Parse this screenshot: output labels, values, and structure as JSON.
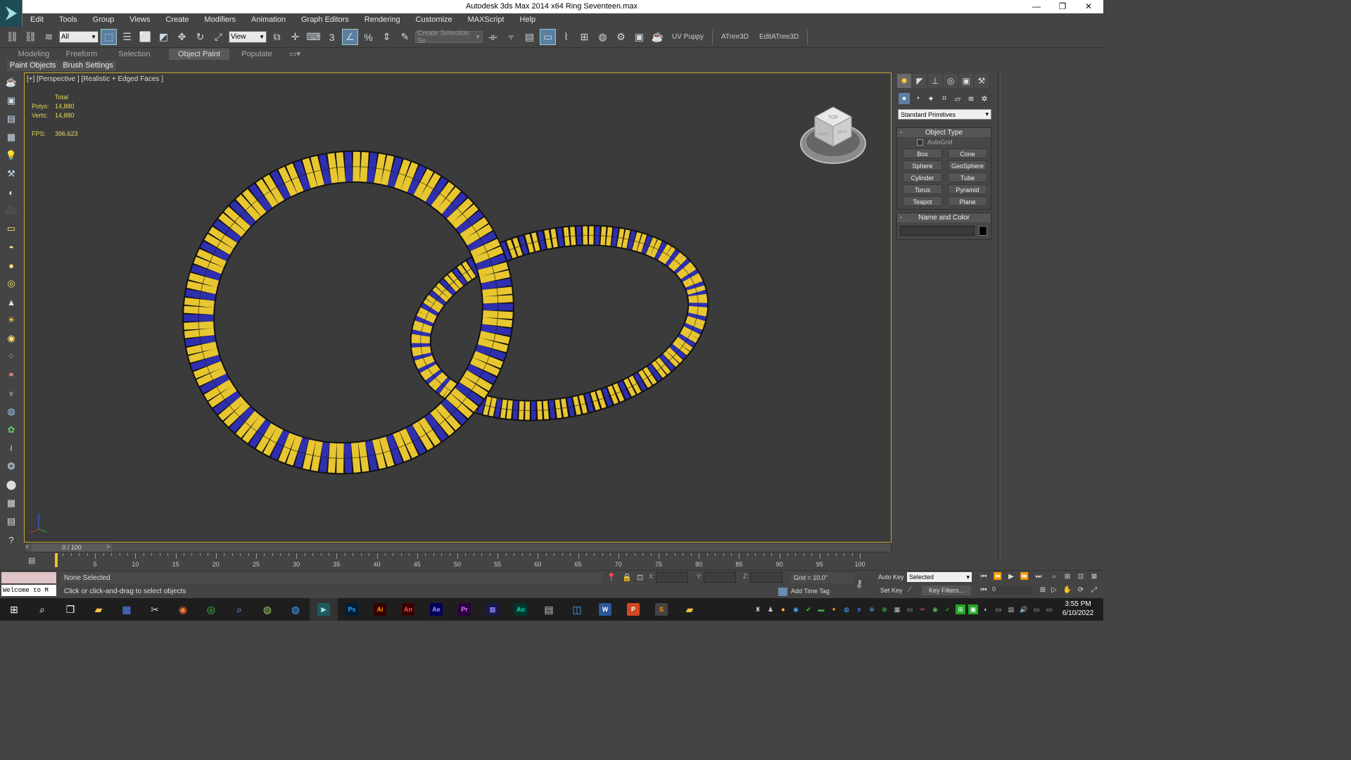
{
  "window": {
    "title": "Autodesk 3ds Max  2014 x64     Ring Seventeen.max",
    "minimize": "—",
    "restore": "❐",
    "close": "✕"
  },
  "menu": [
    "Edit",
    "Tools",
    "Group",
    "Views",
    "Create",
    "Modifiers",
    "Animation",
    "Graph Editors",
    "Rendering",
    "Customize",
    "MAXScript",
    "Help"
  ],
  "toolbar": {
    "selection_filter": "All",
    "ref_coord": "View",
    "named_selection": "Create Selection Se",
    "uv_puppy": "UV Puppy",
    "atree": "ATree3D",
    "editatree": "EditATree3D",
    "snap_2d": "3",
    "percent_snap": "%"
  },
  "ribbon": {
    "tabs": [
      "Modeling",
      "Freeform",
      "Selection",
      "Object Paint",
      "Populate"
    ],
    "active_tab": "Object Paint",
    "subtabs": [
      "Paint Objects",
      "Brush Settings"
    ]
  },
  "viewport": {
    "label": "[+] [Perspective ] [Realistic + Edged Faces ]",
    "stats": {
      "header": "Total",
      "polys_label": "Polys:",
      "polys": "14,880",
      "verts_label": "Verts:",
      "verts": "14,880",
      "fps_label": "FPS:",
      "fps": "396.623"
    },
    "viewcube": {
      "top": "TOP",
      "left": "RIGHT",
      "right": "BACK"
    },
    "ring_colors": {
      "gold": "#e8c630",
      "blue": "#2f2fb0",
      "edge": "#1a1a10"
    }
  },
  "command_panel": {
    "category": "Standard Primitives",
    "object_type": {
      "title": "Object Type",
      "autogrid": "AutoGrid",
      "buttons": [
        "Box",
        "Cone",
        "Sphere",
        "GeoSphere",
        "Cylinder",
        "Tube",
        "Torus",
        "Pyramid",
        "Teapot",
        "Plane"
      ]
    },
    "name_color": {
      "title": "Name and Color",
      "name": ""
    }
  },
  "timeline": {
    "slider": "0 / 100",
    "ticks": [
      "5",
      "10",
      "15",
      "20",
      "25",
      "30",
      "35",
      "40",
      "45",
      "50",
      "55",
      "60",
      "65",
      "70",
      "75",
      "80",
      "85",
      "90",
      "95",
      "100"
    ]
  },
  "status": {
    "welcome": "Welcome to M",
    "selection": "None Selected",
    "prompt": "Click or click-and-drag to select objects",
    "x": "X:",
    "y": "Y:",
    "z": "Z:",
    "grid": "Grid = 10.0\"",
    "add_time_tag": "Add Time Tag",
    "auto_key": "Auto Key",
    "set_key": "Set Key",
    "key_mode": "Selected",
    "key_filters": "Key Filters...",
    "frame": "0"
  },
  "taskbar": {
    "apps": [
      "Ps",
      "Ai",
      "An",
      "Ae",
      "Pr",
      "Au"
    ],
    "time": "3:55 PM",
    "date": "6/10/2022"
  }
}
